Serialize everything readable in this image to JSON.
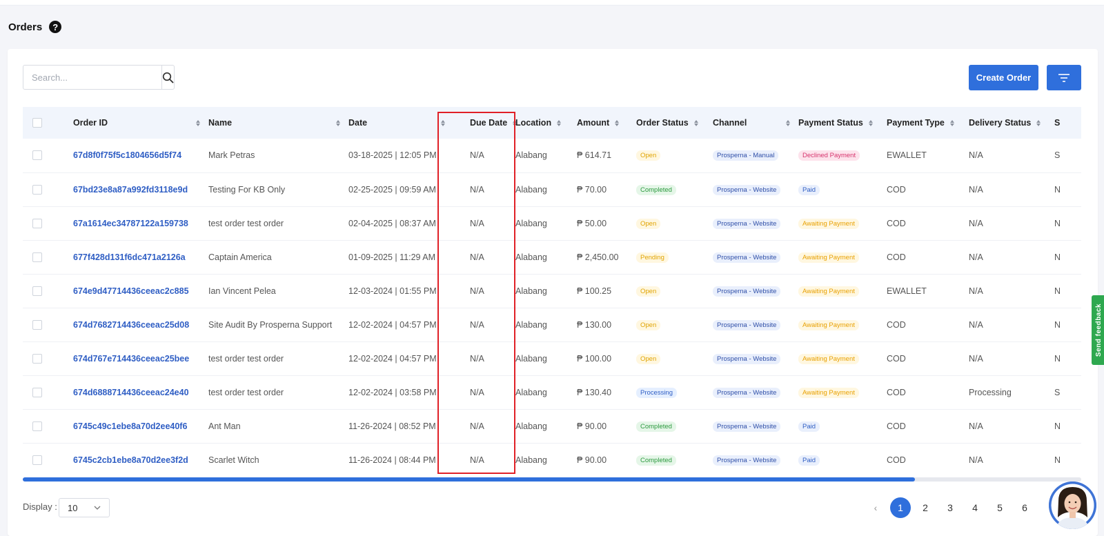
{
  "page": {
    "title": "Orders",
    "help_icon": "?"
  },
  "search": {
    "placeholder": "Search..."
  },
  "actions": {
    "create_label": "Create Order"
  },
  "table": {
    "columns": [
      "Order ID",
      "Name",
      "Date",
      "Due Date",
      "Location",
      "Amount",
      "Order Status",
      "Channel",
      "Payment Status",
      "Payment Type",
      "Delivery Status",
      "S"
    ],
    "rows": [
      {
        "order_id": "67d8f0f75f5c1804656d5f74",
        "name": "Mark Petras",
        "date": "03-18-2025 | 12:05 PM",
        "due_date": "N/A",
        "location": "Alabang",
        "amount": "₱ 614.71",
        "order_status": "Open",
        "channel": "Prosperna - Manual",
        "payment_status": "Declined Payment",
        "payment_type": "EWALLET",
        "delivery_status": "N/A",
        "extra": "S"
      },
      {
        "order_id": "67bd23e8a87a992fd3118e9d",
        "name": "Testing For KB Only",
        "date": "02-25-2025 | 09:59 AM",
        "due_date": "N/A",
        "location": "Alabang",
        "amount": "₱ 70.00",
        "order_status": "Completed",
        "channel": "Prosperna - Website",
        "payment_status": "Paid",
        "payment_type": "COD",
        "delivery_status": "N/A",
        "extra": "N"
      },
      {
        "order_id": "67a1614ec34787122a159738",
        "name": "test order test order",
        "date": "02-04-2025 | 08:37 AM",
        "due_date": "N/A",
        "location": "Alabang",
        "amount": "₱ 50.00",
        "order_status": "Open",
        "channel": "Prosperna - Website",
        "payment_status": "Awaiting Payment",
        "payment_type": "COD",
        "delivery_status": "N/A",
        "extra": "N"
      },
      {
        "order_id": "677f428d131f6dc471a2126a",
        "name": "Captain America",
        "date": "01-09-2025 | 11:29 AM",
        "due_date": "N/A",
        "location": "Alabang",
        "amount": "₱ 2,450.00",
        "order_status": "Pending",
        "channel": "Prosperna - Website",
        "payment_status": "Awaiting Payment",
        "payment_type": "COD",
        "delivery_status": "N/A",
        "extra": "N"
      },
      {
        "order_id": "674e9d47714436ceeac2c885",
        "name": "Ian Vincent Pelea",
        "date": "12-03-2024 | 01:55 PM",
        "due_date": "N/A",
        "location": "Alabang",
        "amount": "₱ 100.25",
        "order_status": "Open",
        "channel": "Prosperna - Website",
        "payment_status": "Awaiting Payment",
        "payment_type": "EWALLET",
        "delivery_status": "N/A",
        "extra": "N"
      },
      {
        "order_id": "674d7682714436ceeac25d08",
        "name": "Site Audit By Prosperna Support",
        "date": "12-02-2024 | 04:57 PM",
        "due_date": "N/A",
        "location": "Alabang",
        "amount": "₱ 130.00",
        "order_status": "Open",
        "channel": "Prosperna - Website",
        "payment_status": "Awaiting Payment",
        "payment_type": "COD",
        "delivery_status": "N/A",
        "extra": "N"
      },
      {
        "order_id": "674d767e714436ceeac25bee",
        "name": "test order test order",
        "date": "12-02-2024 | 04:57 PM",
        "due_date": "N/A",
        "location": "Alabang",
        "amount": "₱ 100.00",
        "order_status": "Open",
        "channel": "Prosperna - Website",
        "payment_status": "Awaiting Payment",
        "payment_type": "COD",
        "delivery_status": "N/A",
        "extra": "N"
      },
      {
        "order_id": "674d6888714436ceeac24e40",
        "name": "test order test order",
        "date": "12-02-2024 | 03:58 PM",
        "due_date": "N/A",
        "location": "Alabang",
        "amount": "₱ 130.40",
        "order_status": "Processing",
        "channel": "Prosperna - Website",
        "payment_status": "Awaiting Payment",
        "payment_type": "COD",
        "delivery_status": "Processing",
        "extra": "S"
      },
      {
        "order_id": "6745c49c1ebe8a70d2ee40f6",
        "name": "Ant Man",
        "date": "11-26-2024 | 08:52 PM",
        "due_date": "N/A",
        "location": "Alabang",
        "amount": "₱ 90.00",
        "order_status": "Completed",
        "channel": "Prosperna - Website",
        "payment_status": "Paid",
        "payment_type": "COD",
        "delivery_status": "N/A",
        "extra": "N"
      },
      {
        "order_id": "6745c2cb1ebe8a70d2ee3f2d",
        "name": "Scarlet Witch",
        "date": "11-26-2024 | 08:44 PM",
        "due_date": "N/A",
        "location": "Alabang",
        "amount": "₱ 90.00",
        "order_status": "Completed",
        "channel": "Prosperna - Website",
        "payment_status": "Paid",
        "payment_type": "COD",
        "delivery_status": "N/A",
        "extra": "N"
      }
    ]
  },
  "footer": {
    "display_label": "Display :",
    "display_value": "10",
    "pages": [
      "1",
      "2",
      "3",
      "4",
      "5",
      "6"
    ],
    "prev_icon": "‹"
  },
  "feedback": {
    "label": "Send feedback"
  },
  "colors": {
    "primary": "#2f6fdc",
    "highlight": "#e01f26",
    "feedback": "#2ea84f"
  }
}
